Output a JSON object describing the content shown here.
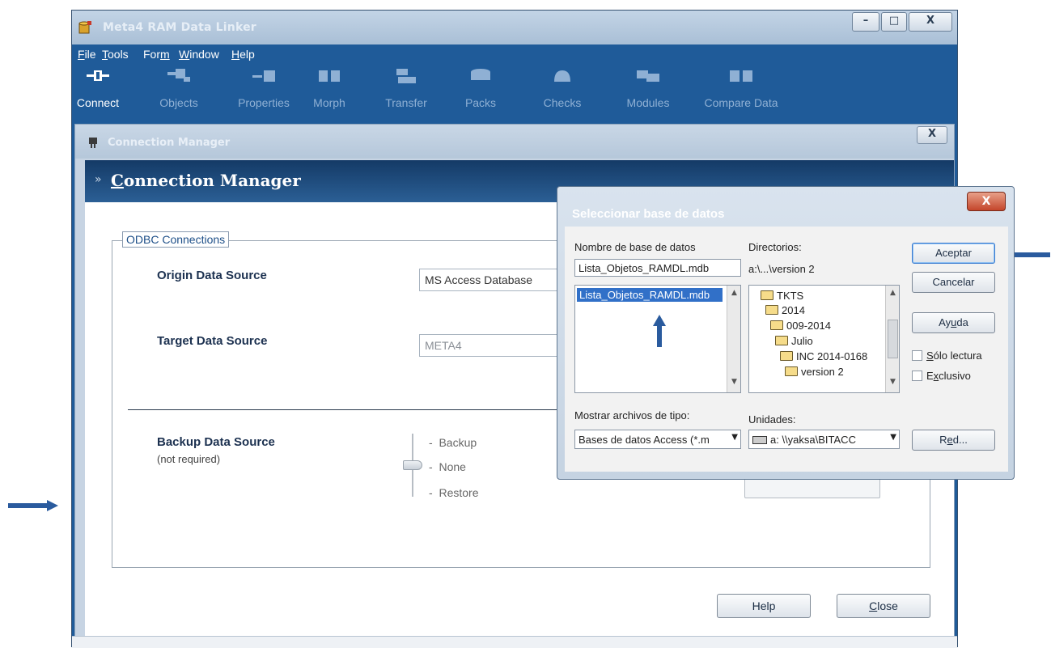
{
  "app": {
    "title": "Meta4 RAM Data Linker",
    "caption_buttons": {
      "minimize": "–",
      "maximize": "□",
      "close": "X"
    }
  },
  "menu": [
    {
      "label": "File",
      "accel": "F",
      "rest": "ile"
    },
    {
      "label": "Tools",
      "accel": "T",
      "rest": "ools"
    },
    {
      "label": "Form",
      "pre": "For",
      "accel": "m",
      "rest": ""
    },
    {
      "label": "Window",
      "accel": "W",
      "rest": "indow"
    },
    {
      "label": "Help",
      "accel": "H",
      "rest": "elp"
    }
  ],
  "toolbar": [
    {
      "label": "Connect",
      "icon": "connect-icon"
    },
    {
      "label": "Objects",
      "icon": "objects-icon"
    },
    {
      "label": "Properties",
      "icon": "properties-icon"
    },
    {
      "label": "Morph",
      "icon": "morph-icon"
    },
    {
      "label": "Transfer",
      "icon": "transfer-icon"
    },
    {
      "label": "Packs",
      "icon": "packs-icon"
    },
    {
      "label": "Checks",
      "icon": "checks-icon"
    },
    {
      "label": "Modules",
      "icon": "modules-icon"
    },
    {
      "label": "Compare Data",
      "icon": "compare-data-icon"
    }
  ],
  "connection_manager": {
    "window_title": "Connection Manager",
    "close": "X",
    "header_accel": "C",
    "header_rest": "onnection Manager",
    "group_label": "ODBC Connections",
    "origin": {
      "label": "Origin Data Source",
      "value": "MS Access Database"
    },
    "target": {
      "label": "Target Data Source",
      "value": "META4"
    },
    "backup": {
      "label": "Backup Data Source",
      "note": "(not required)",
      "options": [
        "Backup",
        "None",
        "Restore"
      ]
    },
    "buttons": {
      "help": "Help",
      "close_accel": "C",
      "close_rest": "lose"
    }
  },
  "dialog": {
    "title": "Seleccionar base de datos",
    "close": "X",
    "db_name_label": "Nombre de base de datos",
    "db_name_value": "Lista_Objetos_RAMDL.mdb",
    "file_list": [
      "Lista_Objetos_RAMDL.mdb"
    ],
    "dirs_label": "Directorios:",
    "dirs_path": "a:\\...\\version 2",
    "dir_tree": [
      "TKTS",
      "2014",
      "009-2014",
      "Julio",
      "INC 2014-0168",
      "version 2"
    ],
    "file_type_label": "Mostrar archivos de tipo:",
    "file_type_value": "Bases de datos Access (*.m",
    "drives_label": "Unidades:",
    "drives_value": "a: \\\\yaksa\\BITACC",
    "buttons": {
      "accept": "Aceptar",
      "cancel": "Cancelar",
      "help_pre": "Ay",
      "help_accel": "u",
      "help_rest": "da",
      "network_pre": "R",
      "network_accel": "e",
      "network_rest": "d..."
    },
    "readonly": {
      "accel": "S",
      "rest": "ólo lectura",
      "checked": false
    },
    "exclusive": {
      "pre": "E",
      "accel": "x",
      "rest": "clusivo",
      "checked": false
    }
  },
  "colors": {
    "frame_blue": "#1f5b99",
    "header_dark": "#143a66",
    "selection": "#3170c8",
    "annotation_arrow": "#2a5b9e"
  }
}
